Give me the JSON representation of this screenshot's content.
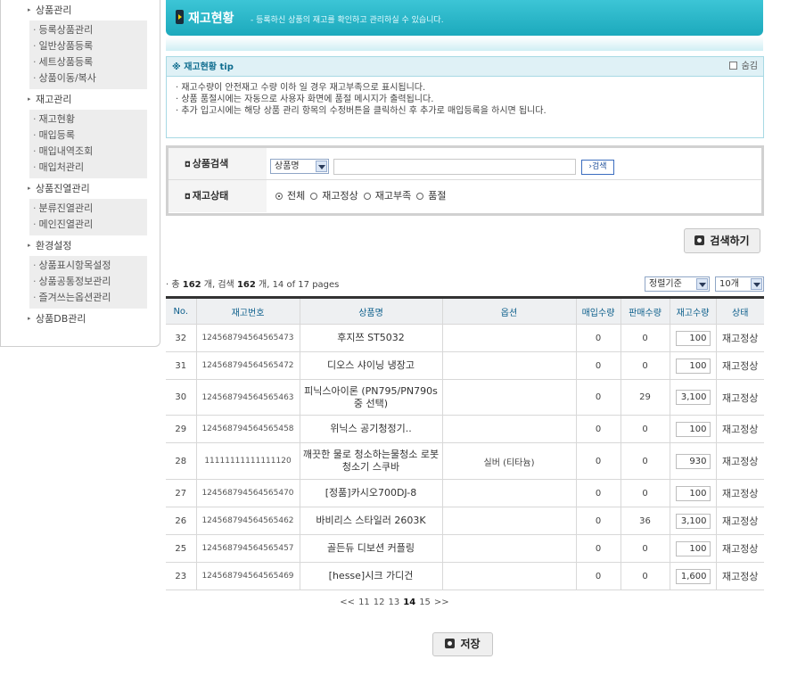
{
  "sidebar": {
    "sections": [
      {
        "title": "상품관리",
        "items": [
          "등록상품관리",
          "일반상품등록",
          "세트상품등록",
          "상품이동/복사"
        ]
      },
      {
        "title": "재고관리",
        "items": [
          "재고현황",
          "매입등록",
          "매입내역조회",
          "매입처관리"
        ]
      },
      {
        "title": "상품진열관리",
        "items": [
          "분류진열관리",
          "메인진열관리"
        ]
      },
      {
        "title": "환경설정",
        "items": [
          "상품표시항목설정",
          "상품공통정보관리",
          "즐겨쓰는옵션관리"
        ]
      },
      {
        "title": "상품DB관리",
        "items": []
      }
    ]
  },
  "header": {
    "title": "재고현황",
    "description": "-  등록하신 상품의 재고를 확인하고 관리하실 수 있습니다."
  },
  "tip": {
    "title": "※ 재고현황 tip",
    "hide_label": "숨김",
    "lines": [
      "· 재고수량이 안전재고 수량 이하 일 경우 재고부족으로 표시됩니다.",
      "· 상품 품절시에는 자동으로 사용자 화면에 품절 메시지가 출력됩니다.",
      "· 추가 입고시에는 해당 상품 관리 항목의 수정버튼을 클릭하신 후 추가로 매입등록을 하시면 됩니다."
    ]
  },
  "search": {
    "product_label": "상품검색",
    "field_select": "상품명",
    "keyword": "",
    "search_btn": "›검색",
    "status_label": "재고상태",
    "status_options": [
      "전체",
      "재고정상",
      "재고부족",
      "품절"
    ],
    "status_selected": 0,
    "big_btn": "검색하기"
  },
  "summary": {
    "prefix": "· 총 ",
    "total": "162",
    "mid": " 개, 검색 ",
    "found": "162",
    "suffix": " 개, 14 of 17 pages",
    "sort": "정렬기준",
    "per_page": "10개"
  },
  "table": {
    "headers": [
      "No.",
      "재고번호",
      "상품명",
      "옵션",
      "매입수량",
      "판매수량",
      "재고수량",
      "상태"
    ],
    "rows": [
      {
        "no": "32",
        "code": "124568794564565473",
        "name": "후지쯔 ST5032",
        "option": "",
        "buy": "0",
        "sell": "0",
        "stock": "100",
        "status": "재고정상"
      },
      {
        "no": "31",
        "code": "124568794564565472",
        "name": "디오스 샤이닝 냉장고",
        "option": "",
        "buy": "0",
        "sell": "0",
        "stock": "100",
        "status": "재고정상"
      },
      {
        "no": "30",
        "code": "124568794564565463",
        "name": "피닉스아이론 (PN795/PN790s 중 선택)",
        "option": "",
        "buy": "0",
        "sell": "29",
        "stock": "3,100",
        "status": "재고정상"
      },
      {
        "no": "29",
        "code": "124568794564565458",
        "name": "위닉스 공기청정기..",
        "option": "",
        "buy": "0",
        "sell": "0",
        "stock": "100",
        "status": "재고정상"
      },
      {
        "no": "28",
        "code": "11111111111111120",
        "name": "깨끗한 물로 청소하는물청소 로봇청소기 스쿠바",
        "option": "실버 (티타늄)",
        "buy": "0",
        "sell": "0",
        "stock": "930",
        "status": "재고정상"
      },
      {
        "no": "27",
        "code": "124568794564565470",
        "name": "[정품]카시오700DJ-8",
        "option": "",
        "buy": "0",
        "sell": "0",
        "stock": "100",
        "status": "재고정상"
      },
      {
        "no": "26",
        "code": "124568794564565462",
        "name": "바비리스 스타일러 2603K",
        "option": "",
        "buy": "0",
        "sell": "36",
        "stock": "3,100",
        "status": "재고정상"
      },
      {
        "no": "25",
        "code": "124568794564565457",
        "name": "골든듀 디보션 커플링",
        "option": "",
        "buy": "0",
        "sell": "0",
        "stock": "100",
        "status": "재고정상"
      },
      {
        "no": "23",
        "code": "124568794564565469",
        "name": "[hesse]시크 가디건",
        "option": "",
        "buy": "0",
        "sell": "0",
        "stock": "1,600",
        "status": "재고정상"
      }
    ]
  },
  "pagination": {
    "prev": "<<",
    "pages": [
      "11",
      "12",
      "13",
      "14",
      "15"
    ],
    "current": "14",
    "next": ">>"
  },
  "save_label": "저장",
  "colors": {
    "header": "#1ca9bc",
    "tip_border": "#a7d9e4",
    "link": "#0d5f8c"
  }
}
